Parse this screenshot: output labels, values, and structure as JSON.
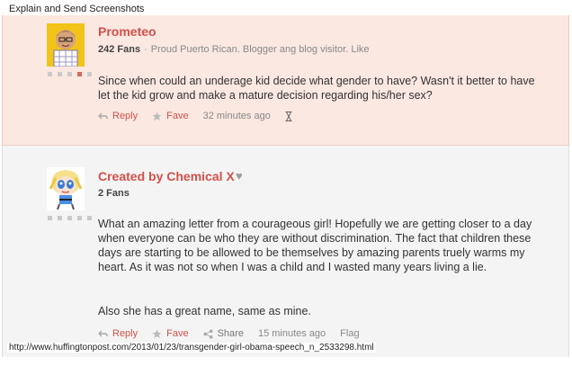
{
  "window": {
    "title": "Explain and Send Screenshots"
  },
  "comments": [
    {
      "username": "Prometeo",
      "fans": "242 Fans",
      "bio": "Proud Puerto Rican. Blogger ang blog visitor. Like",
      "body": "Since when could an underage kid decide what gender to have? Wasn't it better to have let the kid grow and make a mature decision regarding his/her sex?",
      "actions": {
        "reply": "Reply",
        "fave": "Fave",
        "time": "32 minutes ago"
      }
    },
    {
      "username": "Created by Chemical X",
      "fans": "2 Fans",
      "body": "What an amazing letter from a courageous girl! Hopefully we are getting closer to a day when everyone can be who they are without discrimination. The fact that children these days are starting to be allowed to be themselves by amazing parents truely warms my heart. As it was not so when I was a child and I wasted many years living a lie.",
      "body2": "Also she has a great name, same as mine.",
      "actions": {
        "reply": "Reply",
        "fave": "Fave",
        "share": "Share",
        "time": "15 minutes ago",
        "flag": "Flag"
      }
    }
  ],
  "footer": {
    "url": "http://www.huffingtonpost.com/2013/01/23/transgender-girl-obama-speech_n_2533298.html"
  },
  "colors": {
    "accent": "#d4504a",
    "highlight_bg": "#fbe8e1",
    "comment_bg": "#f4f4f4"
  },
  "icons": [
    "reply-icon",
    "star-icon",
    "share-icon",
    "hourglass-icon",
    "heart-icon"
  ]
}
